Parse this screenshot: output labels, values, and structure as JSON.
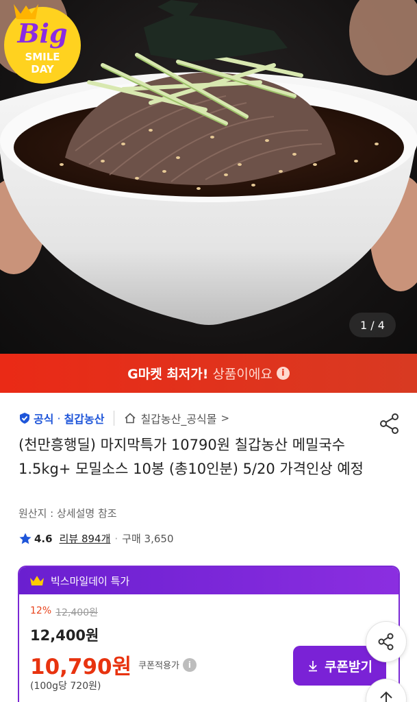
{
  "hero": {
    "image_counter": "1 / 4",
    "badge": {
      "line1": "Big",
      "line2": "SMILE",
      "line3": "DAY"
    }
  },
  "banner": {
    "strong_text": "G마켓 최저가!",
    "light_text": "상품이에요",
    "info_glyph": "i"
  },
  "seller": {
    "official_label": "공식",
    "separator_dot": "·",
    "seller_name": "칠갑농산",
    "store_name": "칠갑농산_공식몰",
    "store_chevron": ">"
  },
  "product": {
    "title": "(천만흥행딜) 마지막특가 10790원 칠갑농산 메밀국수 1.5kg+ 모밀소스 10봉 (총10인분) 5/20 가격인상 예정",
    "origin": "원산지 : 상세설명 참조",
    "rating": "4.6",
    "review_text": "리뷰 894개",
    "separator_dot": "·",
    "purchase_text": "구매 3,650"
  },
  "deal": {
    "header": "빅스마일데이 특가",
    "discount_percent": "12%",
    "original_price": "12,400원",
    "price": "12,400원",
    "final_price": "10,790원",
    "coupon_label": "쿠폰적용가",
    "info_glyph": "i",
    "unit_price": "(100g당 720원)",
    "coupon_button": "쿠폰받기"
  },
  "colors": {
    "banner_red": "#e5341c",
    "brand_blue": "#1e55d9",
    "deal_purple": "#7a22d6",
    "price_red": "#e8330f"
  },
  "icons": [
    "shield-check-icon",
    "home-icon",
    "share-icon",
    "star-icon",
    "crown-icon",
    "download-icon",
    "arrow-up-icon",
    "info-icon"
  ]
}
